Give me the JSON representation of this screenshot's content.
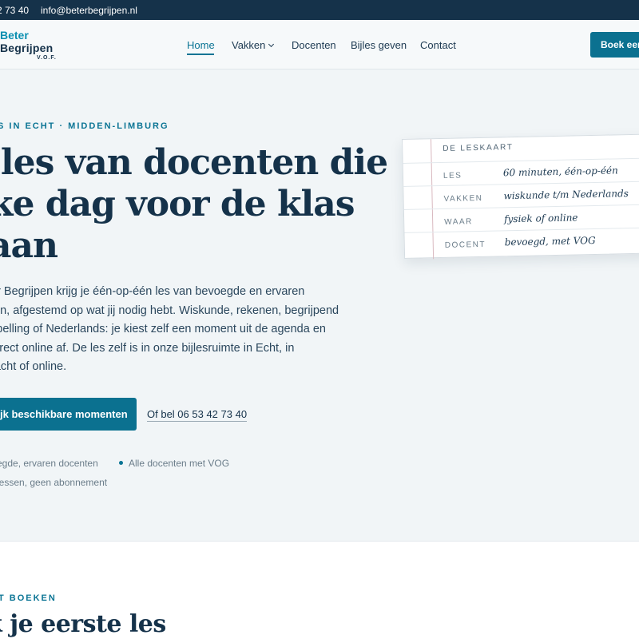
{
  "topbar": {
    "phone": "2 73 40",
    "email": "info@beterbegrijpen.nl"
  },
  "logo": {
    "line1": "Beter",
    "line2": "Begrijpen",
    "line3": "V.O.F."
  },
  "nav": {
    "items": [
      {
        "label": "Home",
        "active": true
      },
      {
        "label": "Vakken",
        "has_dropdown": true
      },
      {
        "label": "Docenten"
      },
      {
        "label": "Bijles geven"
      },
      {
        "label": "Contact"
      }
    ],
    "book_button": "Boek een"
  },
  "hero": {
    "eyebrow": "S IN ECHT · MIDDEN-LIMBURG",
    "title_lines": [
      "jles van docenten die",
      "ke dag voor de klas",
      "aan"
    ],
    "intro_lines": [
      "er Begrijpen krijg je één-op-één les van bevoegde en ervaren",
      "ten, afgestemd op wat jij nodig hebt. Wiskunde, rekenen, begrijpend",
      "spelling of Nederlands: je kiest zelf een moment uit de agenda en",
      " direct online af. De les zelf is in onze bijlesruimte in Echt, in",
      "racht of online."
    ],
    "cta_button": "jk beschikbare momenten",
    "call_link": "Of bel 06 53 42 73 40",
    "features": [
      "egde, ervaren docenten",
      "Alle docenten met VOG",
      " lessen, geen abonnement"
    ]
  },
  "lesson_card": {
    "title": "DE LESKAART",
    "rows": [
      {
        "key": "LES",
        "value": "60 minuten, één-op-één"
      },
      {
        "key": "VAKKEN",
        "value": "wiskunde t/m Nederlands"
      },
      {
        "key": "WAAR",
        "value": "fysiek of online"
      },
      {
        "key": "DOCENT",
        "value": "bevoegd, met VOG"
      }
    ]
  },
  "section2": {
    "eyebrow": "T BOEKEN",
    "title": "k je eerste les"
  },
  "colors": {
    "accent": "#0b7190",
    "dark": "#15324a",
    "background": "#f1f5f7"
  }
}
